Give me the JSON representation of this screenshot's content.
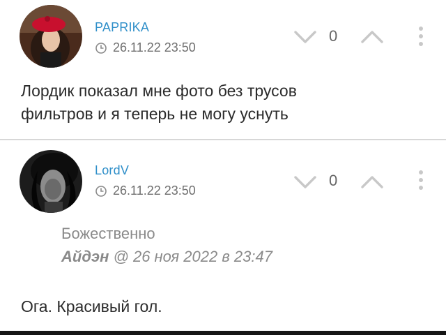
{
  "comments": [
    {
      "username": "PAPRIKA",
      "timestamp": "26.11.22 23:50",
      "votes": "0",
      "text_lines": [
        "Лордик показал мне фото без трусов",
        "фильтров и я теперь не могу уснуть"
      ]
    },
    {
      "username": "LordV",
      "timestamp": "26.11.22 23:50",
      "votes": "0",
      "quote": {
        "text": "Божественно",
        "author": "Айдэн",
        "separator": "@",
        "date": "26 ноя 2022 в 23:47"
      },
      "text": "Ога. Красивый гол."
    }
  ],
  "colors": {
    "username": "#2f8fc9",
    "meta": "#6f6f6f",
    "body": "#2b2b2b",
    "quote": "#8a8a8a",
    "icon": "#c8c8c8",
    "divider": "#d7d7d7"
  },
  "icons": {
    "vote_down": "chevron-down-icon",
    "vote_up": "chevron-up-icon",
    "more": "more-vertical-icon",
    "time": "clock-icon"
  }
}
